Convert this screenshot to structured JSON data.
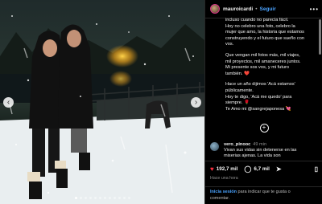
{
  "post": {
    "username": "mauroicardi",
    "separator": "•",
    "follow_label": "Seguir",
    "more_icon": "more-horizontal-icon"
  },
  "caption": {
    "p1_l1": "incluso cuando no parecía fácil.",
    "p1_l2": "Hoy no celebro una foto, celebro la",
    "p1_l3": "mujer que amo, la historia que estamos",
    "p1_l4": "construyendo y el futuro que sueño con",
    "p1_l5": "vos.",
    "p2_l1": "Que vengan mil fotos más, mil viajes,",
    "p2_l2": "mil proyectos, mil amaneceres juntos.",
    "p2_l3": "Mi presente sos vos, y mi futuro",
    "p2_l4": "también. ❤️",
    "p3_l1": "Hace un año dijimos 'Acá estamos'",
    "p3_l2": "públicamente.",
    "p3_l3": "Hoy te digo, 'Acá me quedo' para",
    "p3_l4": "siempre. 🌹",
    "p3_l5": "Te Amo mi @sangrejaponesa 💘"
  },
  "comment": {
    "username": "vero_pinooc",
    "time": "49 min",
    "text_l1": "Vivan sus vidas sin detenerse en las",
    "text_l2": "miserias ajenas. La vida son"
  },
  "actions": {
    "likes": "192,7 mil",
    "comments": "6,7 mil"
  },
  "timestamp": "Hace una hora",
  "login": {
    "link": "Inicia sesión",
    "text_l1": " para indicar que te gusta o",
    "text_l2": "comentar."
  },
  "carousel": {
    "prev_icon": "chevron-left-icon",
    "next_icon": "chevron-right-icon",
    "slide_count": 12,
    "active_slide": 1
  },
  "colors": {
    "link": "#4aa3ff",
    "heart": "#ff3040",
    "story_ring": "#d63384"
  }
}
